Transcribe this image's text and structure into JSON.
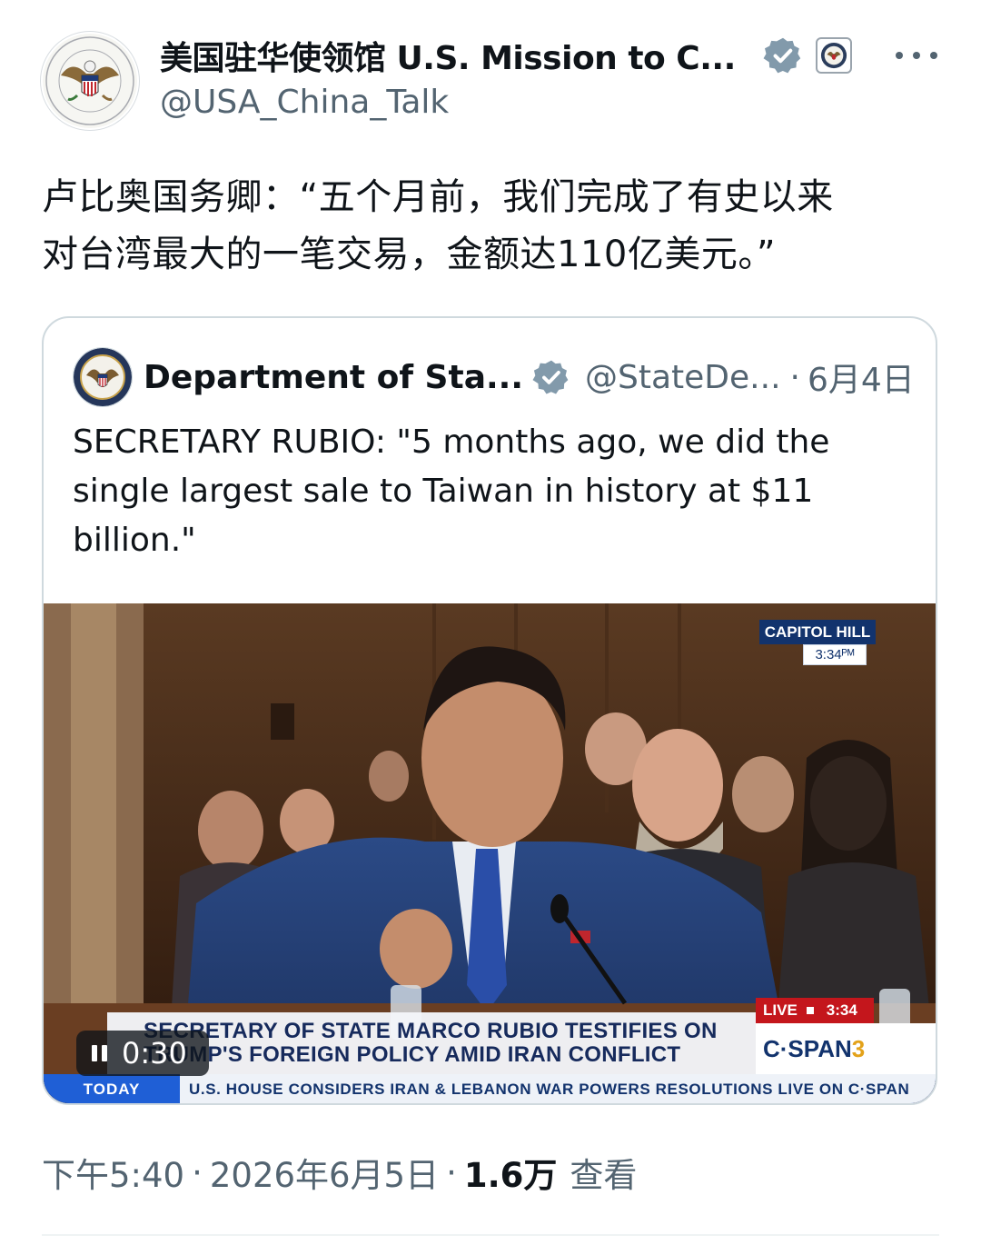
{
  "author": {
    "display_name": "美国驻华使领馆 U.S. Mission to C...",
    "handle": "@USA_China_Talk",
    "avatar_icon": "us-eagle-seal-icon",
    "verified_icon": "verified-badge-icon",
    "affiliation_icon": "state-department-seal-icon"
  },
  "more_icon": "more-options-icon",
  "tweet": {
    "text_line1": "卢比奥国务卿：“五个月前，我们完成了有史以来",
    "text_line2": "对台湾最大的一笔交易，金额达110亿美元。”"
  },
  "quoted": {
    "display_name": "Department of Sta...",
    "handle": "@StateDe...",
    "separator": "·",
    "date": "6月4日",
    "text_line1": "SECRETARY RUBIO: \"5 months ago, we did the",
    "text_line2": "single largest sale to Taiwan in history at $11",
    "text_line3": "billion.\"",
    "video": {
      "overlay_location": "CAPITOL HILL",
      "overlay_time": "3:34ᴾᴹ",
      "caption_line1": "SECRETARY OF STATE MARCO RUBIO TESTIFIES ON",
      "caption_line2": "TRUMP'S FOREIGN POLICY AMID IRAN CONFLICT",
      "live_label": "LIVE",
      "live_time": "3:34",
      "network": "C·SPAN",
      "network_num": "3",
      "ticker_label": "TODAY",
      "ticker_text": "U.S. HOUSE CONSIDERS IRAN & LEBANON WAR POWERS RESOLUTIONS  LIVE ON C·SPAN",
      "duration": "0:30",
      "pause_icon": "pause-icon"
    }
  },
  "meta": {
    "time": "下午5:40",
    "dot1": "·",
    "date": "2026年6月5日",
    "dot2": "·",
    "views_count": "1.6万",
    "views_label": "查看"
  },
  "colors": {
    "text_primary": "#0f1419",
    "text_secondary": "#536471",
    "border": "#cfd9de",
    "verified": "#829aab",
    "cspan_blue": "#12336d",
    "live_red": "#c4161c"
  }
}
